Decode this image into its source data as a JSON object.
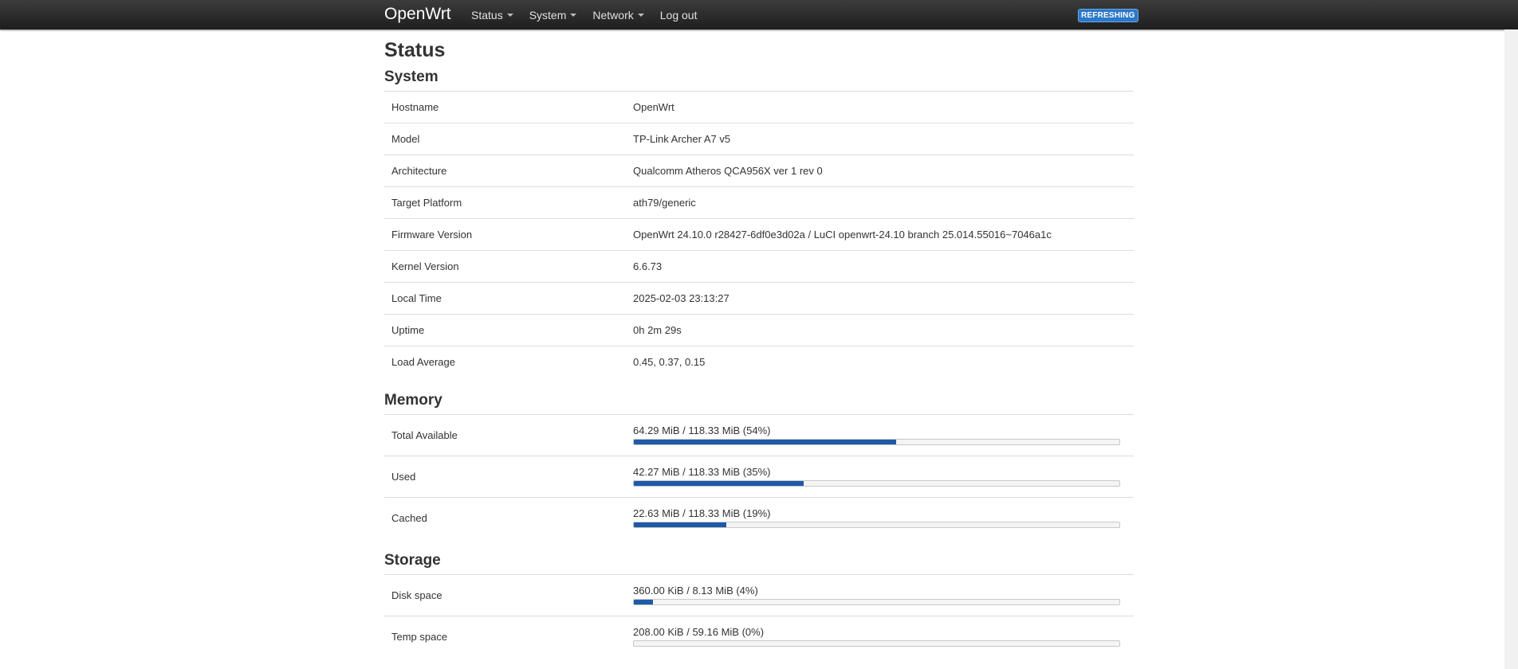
{
  "colors": {
    "navbar": "#2a2a2a",
    "accent": "#1d5aa8",
    "badge": "#2c78c9"
  },
  "nav": {
    "brand": "OpenWrt",
    "menu": [
      {
        "label": "Status",
        "dropdown": true
      },
      {
        "label": "System",
        "dropdown": true
      },
      {
        "label": "Network",
        "dropdown": true
      },
      {
        "label": "Log out",
        "dropdown": false
      }
    ],
    "badge": "REFRESHING"
  },
  "page": {
    "title": "Status"
  },
  "system": {
    "title": "System",
    "rows": [
      {
        "label": "Hostname",
        "value": "OpenWrt"
      },
      {
        "label": "Model",
        "value": "TP-Link Archer A7 v5"
      },
      {
        "label": "Architecture",
        "value": "Qualcomm Atheros QCA956X ver 1 rev 0"
      },
      {
        "label": "Target Platform",
        "value": "ath79/generic"
      },
      {
        "label": "Firmware Version",
        "value": "OpenWrt 24.10.0 r28427-6df0e3d02a / LuCI openwrt-24.10 branch 25.014.55016~7046a1c"
      },
      {
        "label": "Kernel Version",
        "value": "6.6.73"
      },
      {
        "label": "Local Time",
        "value": "2025-02-03 23:13:27"
      },
      {
        "label": "Uptime",
        "value": "0h 2m 29s"
      },
      {
        "label": "Load Average",
        "value": "0.45, 0.37, 0.15"
      }
    ]
  },
  "memory": {
    "title": "Memory",
    "rows": [
      {
        "label": "Total Available",
        "text": "64.29 MiB / 118.33 MiB (54%)",
        "fraction": 0.54
      },
      {
        "label": "Used",
        "text": "42.27 MiB / 118.33 MiB (35%)",
        "fraction": 0.35
      },
      {
        "label": "Cached",
        "text": "22.63 MiB / 118.33 MiB (19%)",
        "fraction": 0.19
      }
    ]
  },
  "storage": {
    "title": "Storage",
    "rows": [
      {
        "label": "Disk space",
        "text": "360.00 KiB / 8.13 MiB (4%)",
        "fraction": 0.04
      },
      {
        "label": "Temp space",
        "text": "208.00 KiB / 59.16 MiB (0%)",
        "fraction": 0.0
      }
    ]
  }
}
